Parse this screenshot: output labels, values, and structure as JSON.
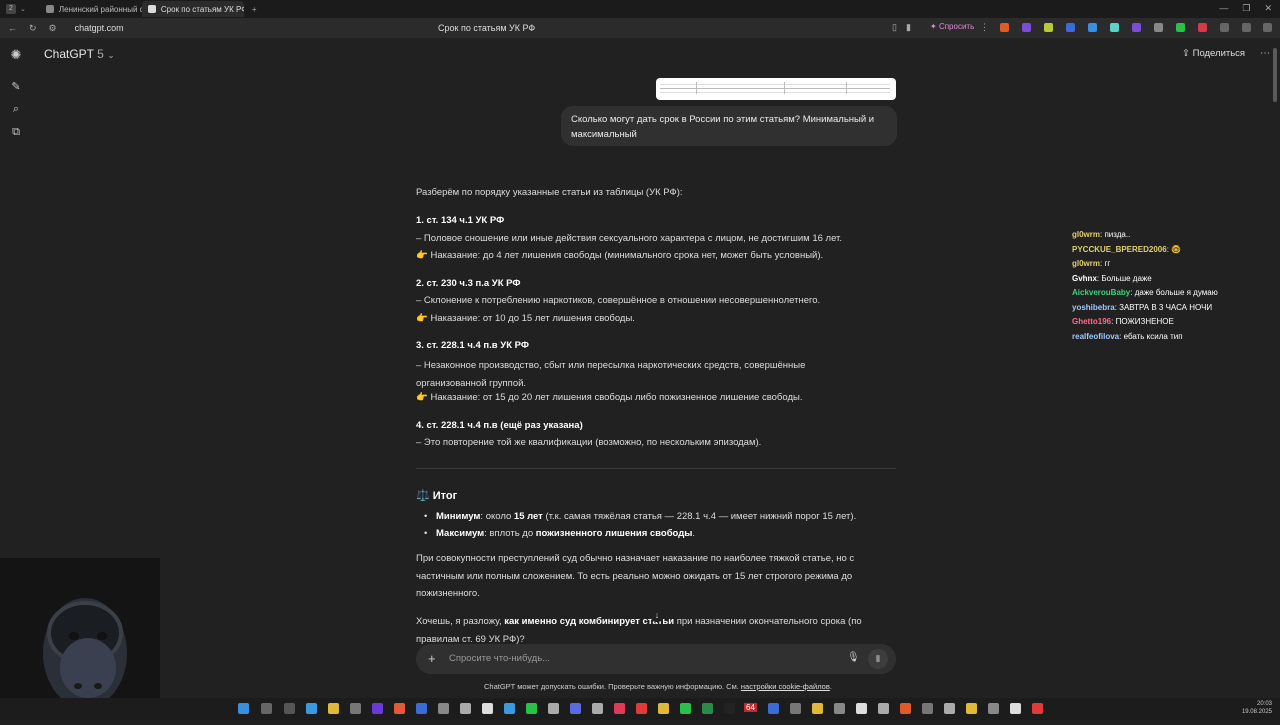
{
  "browser": {
    "tab_counter": "2",
    "tabs": [
      {
        "label": "Ленинский районный суд"
      },
      {
        "label": "Срок по статьям УК РФ"
      }
    ],
    "url": "chatgpt.com",
    "page_title": "Срок по статьям УК РФ",
    "ask_label": "Спросить"
  },
  "header": {
    "model": "ChatGPT",
    "model_version": "5",
    "share_label": "Поделиться"
  },
  "user_message": "Сколько могут дать срок в России по этим статьям? Минимальный и максимальный",
  "answer": {
    "intro": "Разберём по порядку указанные статьи из таблицы (УК РФ):",
    "items": [
      {
        "title": "1. ст. 134 ч.1 УК РФ",
        "lines": [
          "– Половое сношение или иные действия сексуального характера с лицом, не достигшим 16 лет.",
          "👉 Наказание: до 4 лет лишения свободы (минимального срока нет, может быть условный)."
        ]
      },
      {
        "title": "2. ст. 230 ч.3 п.а УК РФ",
        "lines": [
          "– Склонение к потреблению наркотиков, совершённое в отношении несовершеннолетнего.",
          "👉 Наказание: от 10 до 15 лет лишения свободы."
        ]
      },
      {
        "title": "3. ст. 228.1 ч.4 п.в УК РФ",
        "lines": [
          "– Незаконное производство, сбыт или пересылка наркотических средств, совершённые организованной группой.",
          "👉 Наказание: от 15 до 20 лет лишения свободы либо пожизненное лишение свободы."
        ]
      },
      {
        "title": "4. ст. 228.1 ч.4 п.в (ещё раз указана)",
        "lines": [
          "– Это повторение той же квалификации (возможно, по нескольким эпизодам)."
        ]
      }
    ],
    "summary_icon": "⚖️",
    "summary_title": "Итог",
    "bullets": [
      {
        "label": "Минимум",
        "text_a": ": около ",
        "bold": "15 лет",
        "text_b": " (т.к. самая тяжёлая статья — 228.1 ч.4 — имеет нижний порог 15 лет)."
      },
      {
        "label": "Максимум",
        "text_a": ": вплоть до ",
        "bold": "пожизненного лишения свободы",
        "text_b": "."
      }
    ],
    "para": "При совокупности преступлений суд обычно назначает наказание по наиболее тяжкой статье, но с частичным или полным сложением. То есть реально можно ожидать от 15 лет строгого режима до пожизненного.",
    "closing_a": "Хочешь, я разложу, ",
    "closing_bold": "как именно суд комбинирует статьи",
    "closing_b": " при назначении окончательного срока (по правилам ст. 69 УК РФ)?"
  },
  "composer": {
    "placeholder": "Спросите что-нибудь..."
  },
  "disclaimer": {
    "text": "ChatGPT может допускать ошибки. Проверьте важную информацию. См. ",
    "link": "настройки cookie-файлов",
    "end": "."
  },
  "chat_overlay": [
    {
      "user": "gl0wrm",
      "color": "#e0d070",
      "msg": "пизда.."
    },
    {
      "user": "PYCCKUE_BPERED2006",
      "color": "#e0d070",
      "msg": "🤓"
    },
    {
      "user": "gl0wrm",
      "color": "#e0d070",
      "msg": "гг"
    },
    {
      "user": "Gvhnx",
      "color": "#ffffff",
      "msg": "Больше даже"
    },
    {
      "user": "AickverouBaby",
      "color": "#3ed27a",
      "msg": "даже больше я думаю"
    },
    {
      "user": "yoshibebra",
      "color": "#a0c8ff",
      "msg": "ЗАВТРА В 3 ЧАСА НОЧИ"
    },
    {
      "user": "Ghetto196",
      "color": "#ff6a8a",
      "msg": "ПОЖИЗНЕНОЕ"
    },
    {
      "user": "realfeofilova",
      "color": "#9ec8ff",
      "msg": "ебать ксила тип"
    }
  ],
  "taskbar": {
    "badge": "64",
    "time": "20:03",
    "date": "19.08.2025"
  }
}
